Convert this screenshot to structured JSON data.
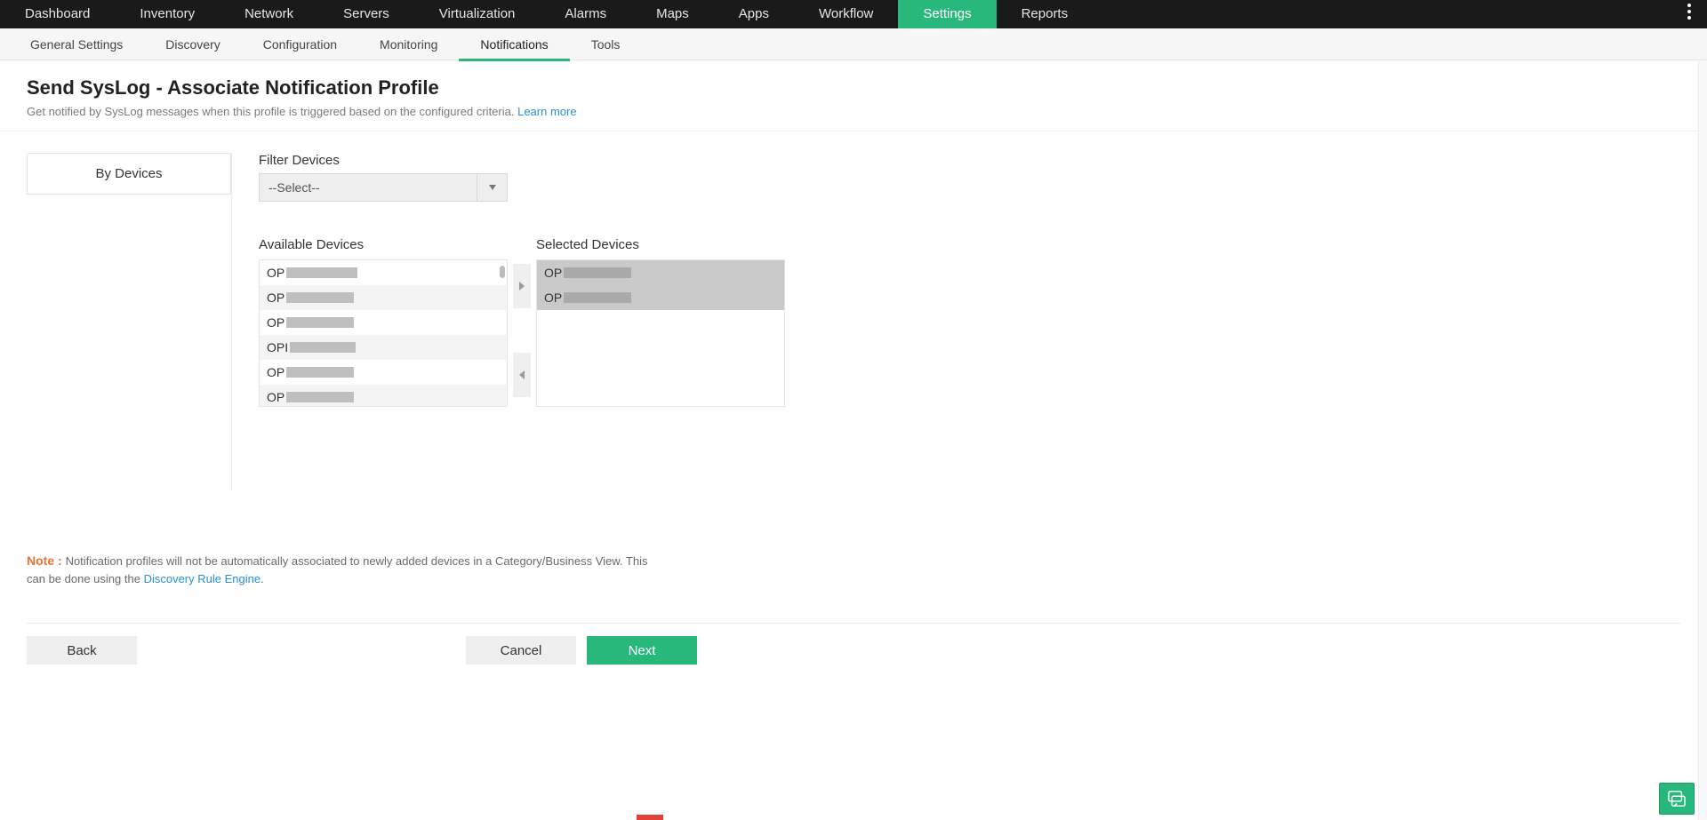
{
  "topnav": {
    "items": [
      "Dashboard",
      "Inventory",
      "Network",
      "Servers",
      "Virtualization",
      "Alarms",
      "Maps",
      "Apps",
      "Workflow",
      "Settings",
      "Reports"
    ],
    "active": "Settings"
  },
  "subnav": {
    "items": [
      "General Settings",
      "Discovery",
      "Configuration",
      "Monitoring",
      "Notifications",
      "Tools"
    ],
    "active": "Notifications"
  },
  "header": {
    "title": "Send SysLog - Associate Notification Profile",
    "desc": "Get notified by SysLog messages when this profile is triggered based on the configured criteria. ",
    "learn_more": "Learn more"
  },
  "left_tab": {
    "by_devices": "By Devices"
  },
  "filter": {
    "label": "Filter Devices",
    "select_placeholder": "--Select--"
  },
  "lists": {
    "available_label": "Available Devices",
    "selected_label": "Selected Devices",
    "available": [
      "OP",
      "OP",
      "OP",
      "OPI",
      "OP",
      "OP"
    ],
    "selected": [
      "OP",
      "OP"
    ]
  },
  "note": {
    "label": "Note : ",
    "text1": "Notification profiles will not be automatically associated to newly added devices in a Category/Business View. This can be done using the ",
    "link": "Discovery Rule Engine",
    "text2": "."
  },
  "buttons": {
    "back": "Back",
    "cancel": "Cancel",
    "next": "Next"
  }
}
